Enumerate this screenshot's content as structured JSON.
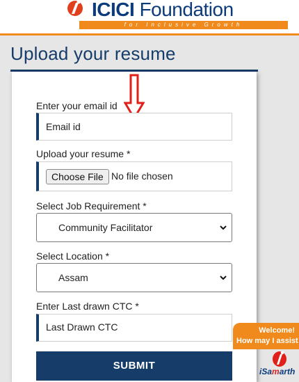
{
  "header": {
    "brand_primary": "ICICI",
    "brand_secondary": "Foundation",
    "tagline": "for Inclusive Growth"
  },
  "page": {
    "title": "Upload your resume"
  },
  "form": {
    "email": {
      "label": "Enter your email id",
      "placeholder": "Email id"
    },
    "resume": {
      "label": "Upload your resume *",
      "button_label": "Choose File",
      "status": "No file chosen"
    },
    "job_requirement": {
      "label": "Select Job Requirement *",
      "selected": "Community Facilitator"
    },
    "location": {
      "label": "Select Location *",
      "selected": "Assam"
    },
    "ctc": {
      "label": "Enter Last drawn CTC *",
      "placeholder": "Last Drawn CTC"
    },
    "submit_label": "SUBMIT"
  },
  "chat_widget": {
    "line1": "Welcome!",
    "line2": "How may I assist",
    "brand_prefix": "iSa",
    "brand_accent": "m",
    "brand_suffix": "arth"
  },
  "colors": {
    "brand_blue": "#163d69",
    "accent_orange": "#f08a1c",
    "annotation_red": "#e0201b"
  },
  "icons": [
    "icici-logo-icon",
    "chevron-down-icon",
    "red-arrow-icon",
    "isamarth-logo-icon"
  ]
}
